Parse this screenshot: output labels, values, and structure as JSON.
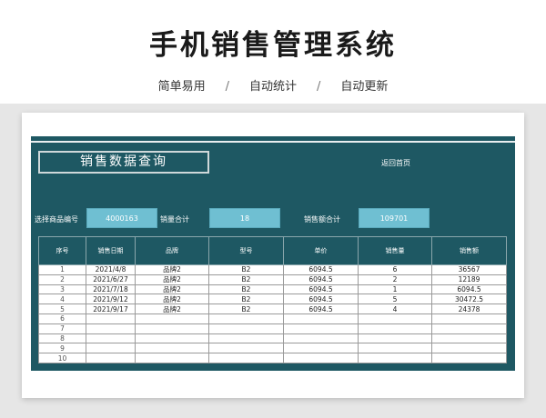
{
  "header": {
    "title": "手机销售管理系统",
    "features": [
      "简单易用",
      "自动统计",
      "自动更新"
    ],
    "separator": "/"
  },
  "panel": {
    "query_title": "销售数据查询",
    "back_link": "返回首页",
    "filters": [
      {
        "label": "选择商品编号",
        "value": "4000163"
      },
      {
        "label": "销量合计",
        "value": "18"
      },
      {
        "label": "销售额合计",
        "value": "109701"
      }
    ]
  },
  "table": {
    "columns": [
      "序号",
      "销售日期",
      "品牌",
      "型号",
      "单价",
      "销售量",
      "销售额"
    ],
    "rows": [
      [
        "1",
        "2021/4/8",
        "品牌2",
        "B2",
        "6094.5",
        "6",
        "36567"
      ],
      [
        "2",
        "2021/6/27",
        "品牌2",
        "B2",
        "6094.5",
        "2",
        "12189"
      ],
      [
        "3",
        "2021/7/18",
        "品牌2",
        "B2",
        "6094.5",
        "1",
        "6094.5"
      ],
      [
        "4",
        "2021/9/12",
        "品牌2",
        "B2",
        "6094.5",
        "5",
        "30472.5"
      ],
      [
        "5",
        "2021/9/17",
        "品牌2",
        "B2",
        "6094.5",
        "4",
        "24378"
      ],
      [
        "6",
        "",
        "",
        "",
        "",
        "",
        ""
      ],
      [
        "7",
        "",
        "",
        "",
        "",
        "",
        ""
      ],
      [
        "8",
        "",
        "",
        "",
        "",
        "",
        ""
      ],
      [
        "9",
        "",
        "",
        "",
        "",
        "",
        ""
      ],
      [
        "10",
        "",
        "",
        "",
        "",
        "",
        ""
      ]
    ]
  },
  "colors": {
    "panel_bg": "#1e5863",
    "field_bg": "#6fbfd2",
    "stage_bg": "#e6e6e6"
  }
}
